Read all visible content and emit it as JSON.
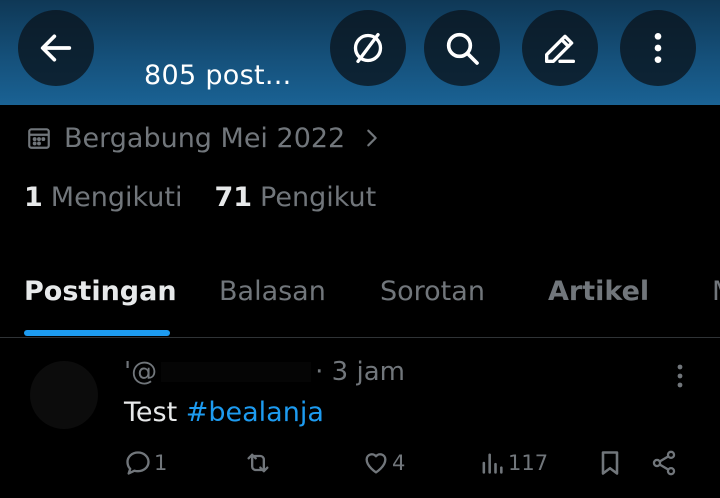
{
  "header": {
    "post_count": "805 post...",
    "back_icon": "arrow-left-icon",
    "compass_icon": "compass-icon",
    "search_icon": "search-icon",
    "edit_icon": "edit-icon",
    "more_icon": "more-vertical-icon"
  },
  "profile": {
    "joined": "Bergabung Mei 2022",
    "following_count": "1",
    "following_label": "Mengikuti",
    "followers_count": "71",
    "followers_label": "Pengikut"
  },
  "tabs": [
    {
      "label": "Postingan",
      "active": true
    },
    {
      "label": "Balasan",
      "active": false
    },
    {
      "label": "Sorotan",
      "active": false
    },
    {
      "label": "Artikel",
      "active": false
    },
    {
      "label": "M",
      "active": false
    }
  ],
  "post": {
    "handle_prefix": "'@",
    "time": "· 3 jam",
    "text": "Test ",
    "hashtag": "#bealanja",
    "replies": "1",
    "likes": "4",
    "views": "117"
  },
  "colors": {
    "accent": "#1d9bf0",
    "muted": "#71767b",
    "text": "#e7e9ea",
    "background": "#000000"
  }
}
